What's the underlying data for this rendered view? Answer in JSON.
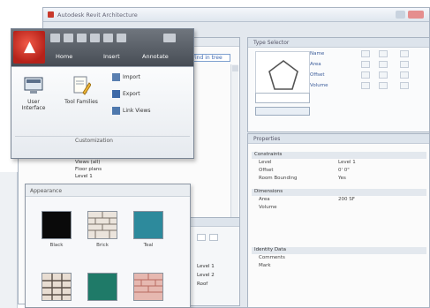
{
  "window": {
    "title": "Autodesk Revit Architecture"
  },
  "ribbon": {
    "tabs": [
      "Home",
      "Insert",
      "Annotate"
    ],
    "tools": [
      {
        "name": "user-interface",
        "label": "User Interface"
      },
      {
        "name": "tool-families",
        "label": "Tool Families"
      }
    ],
    "small_tools": [
      {
        "name": "import",
        "label": "Import"
      },
      {
        "name": "export",
        "label": "Export"
      },
      {
        "name": "link-views",
        "label": "Link Views"
      }
    ],
    "panel_title": "Customization"
  },
  "browser": {
    "search_value": "Find in tree",
    "nodes": [
      "Views (all)",
      "Floor plans",
      "Level 1"
    ]
  },
  "palette": {
    "title": "Appearance",
    "swatches": [
      {
        "name": "black",
        "label": "Black",
        "color": "#0a0a0a"
      },
      {
        "name": "brick",
        "label": "Brick",
        "color": "#ebe4dc"
      },
      {
        "name": "teal",
        "label": "Teal",
        "color": "#2d8a9c"
      },
      {
        "name": "grid",
        "label": "",
        "color": "#e8ddd2"
      },
      {
        "name": "green",
        "label": "",
        "color": "#1f7a68"
      },
      {
        "name": "red-brick",
        "label": "",
        "color": "#e6b8b0"
      }
    ]
  },
  "properties": {
    "title": "Type Selector",
    "labels": [
      "Name",
      "Area",
      "Offset",
      "Volume"
    ],
    "panel_title": "Properties",
    "groups": [
      {
        "group": "Constraints",
        "params": [
          {
            "name": "Level",
            "value": "Level 1"
          },
          {
            "name": "Offset",
            "value": "0' 0\""
          },
          {
            "name": "Room Bounding",
            "value": "Yes"
          }
        ]
      },
      {
        "group": "Dimensions",
        "params": [
          {
            "name": "Area",
            "value": "200 SF"
          },
          {
            "name": "Volume",
            "value": ""
          }
        ]
      },
      {
        "group": "Identity Data",
        "params": [
          {
            "name": "Comments",
            "value": ""
          },
          {
            "name": "Mark",
            "value": ""
          }
        ]
      }
    ]
  },
  "lower_panel": {
    "rows": [
      "Level 1",
      "Level 2",
      "Roof"
    ]
  }
}
